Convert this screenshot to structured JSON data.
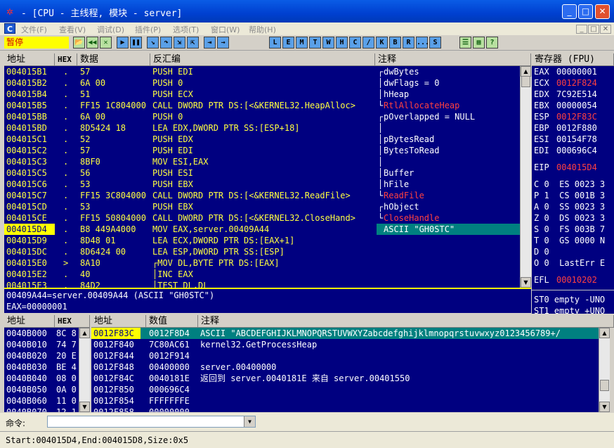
{
  "window": {
    "title": "- [CPU - 主线程, 模块 - server]",
    "minimize_glyph": "_",
    "maximize_glyph": "□",
    "close_glyph": "✕",
    "app_icon_glyph": "✲"
  },
  "menu": {
    "items": [
      "文件(F)",
      "查看(V)",
      "调试(D)",
      "插件(P)",
      "选项(T)",
      "窗口(W)",
      "帮助(H)"
    ]
  },
  "toolbar": {
    "status": "暂停",
    "buttons": [
      {
        "icon": "open-icon",
        "glyph": "📂"
      },
      {
        "icon": "rewind-icon",
        "glyph": "◀◀"
      },
      {
        "icon": "close-program-icon",
        "glyph": "✕"
      },
      {
        "icon": "run-icon",
        "glyph": "▶"
      },
      {
        "icon": "pause-icon",
        "glyph": "❚❚"
      },
      {
        "icon": "step-into-icon",
        "glyph": "↘"
      },
      {
        "icon": "step-over-icon",
        "glyph": "↷"
      },
      {
        "icon": "trace-into-icon",
        "glyph": "⇲"
      },
      {
        "icon": "trace-over-icon",
        "glyph": "⇱"
      },
      {
        "icon": "execute-till-return-icon",
        "glyph": "⇥"
      },
      {
        "icon": "goto-icon",
        "glyph": "→"
      }
    ],
    "letters": [
      "L",
      "E",
      "M",
      "T",
      "W",
      "H",
      "C",
      "/",
      "K",
      "B",
      "R",
      "...",
      "S"
    ],
    "extra": [
      {
        "icon": "list-icon",
        "glyph": "☰"
      },
      {
        "icon": "options-icon",
        "glyph": "▦"
      },
      {
        "icon": "help-icon",
        "glyph": "?"
      }
    ]
  },
  "disasm": {
    "headers": {
      "address": "地址",
      "hex": "HEX",
      "data": "数据",
      "disasm": "反汇编",
      "comment": "注释"
    },
    "rows": [
      {
        "addr": "004015B1",
        "mark": ".",
        "hex": "57",
        "asm": "PUSH EDI",
        "bracket": "┌",
        "comment": "dwBytes",
        "cc": "w"
      },
      {
        "addr": "004015B2",
        "mark": ".",
        "hex": "6A 00",
        "asm": "PUSH 0",
        "bracket": "│",
        "comment": "dwFlags = 0",
        "cc": "w"
      },
      {
        "addr": "004015B4",
        "mark": ".",
        "hex": "51",
        "asm": "PUSH ECX",
        "bracket": "│",
        "comment": "hHeap",
        "cc": "w"
      },
      {
        "addr": "004015B5",
        "mark": ".",
        "hex": "FF15 1C804000",
        "asm": "CALL DWORD PTR DS:[<&KERNEL32.HeapAlloc>",
        "bracket": "└",
        "comment": "RtlAllocateHeap",
        "cc": "r"
      },
      {
        "addr": "004015BB",
        "mark": ".",
        "hex": "6A 00",
        "asm": "PUSH 0",
        "bracket": "┌",
        "comment": "pOverlapped = NULL",
        "cc": "w"
      },
      {
        "addr": "004015BD",
        "mark": ".",
        "hex": "8D5424 18",
        "asm": "LEA EDX,DWORD PTR SS:[ESP+18]",
        "bracket": "│",
        "comment": "",
        "cc": "w"
      },
      {
        "addr": "004015C1",
        "mark": ".",
        "hex": "52",
        "asm": "PUSH EDX",
        "bracket": "│",
        "comment": "pBytesRead",
        "cc": "w"
      },
      {
        "addr": "004015C2",
        "mark": ".",
        "hex": "57",
        "asm": "PUSH EDI",
        "bracket": "│",
        "comment": "BytesToRead",
        "cc": "w"
      },
      {
        "addr": "004015C3",
        "mark": ".",
        "hex": "8BF0",
        "asm": "MOV ESI,EAX",
        "bracket": "│",
        "comment": "",
        "cc": "w"
      },
      {
        "addr": "004015C5",
        "mark": ".",
        "hex": "56",
        "asm": "PUSH ESI",
        "bracket": "│",
        "comment": "Buffer",
        "cc": "w"
      },
      {
        "addr": "004015C6",
        "mark": ".",
        "hex": "53",
        "asm": "PUSH EBX",
        "bracket": "│",
        "comment": "hFile",
        "cc": "w"
      },
      {
        "addr": "004015C7",
        "mark": ".",
        "hex": "FF15 3C804000",
        "asm": "CALL DWORD PTR DS:[<&KERNEL32.ReadFile>",
        "bracket": "└",
        "comment": "ReadFile",
        "cc": "r"
      },
      {
        "addr": "004015CD",
        "mark": ".",
        "hex": "53",
        "asm": "PUSH EBX",
        "bracket": "┌",
        "comment": "hObject",
        "cc": "w"
      },
      {
        "addr": "004015CE",
        "mark": ".",
        "hex": "FF15 50804000",
        "asm": "CALL DWORD PTR DS:[<&KERNEL32.CloseHand>",
        "bracket": "└",
        "comment": "CloseHandle",
        "cc": "r"
      },
      {
        "addr": "004015D4",
        "mark": ".",
        "hex": "B8 449A4000",
        "asm": "MOV EAX,server.00409A44",
        "bracket": "",
        "comment": "ASCII \"GH0STC\"",
        "cc": "w",
        "selected": true
      },
      {
        "addr": "004015D9",
        "mark": ".",
        "hex": "8D48 01",
        "asm": "LEA ECX,DWORD PTR DS:[EAX+1]",
        "bracket": "",
        "comment": "",
        "cc": "w"
      },
      {
        "addr": "004015DC",
        "mark": ".",
        "hex": "8D6424 00",
        "asm": "LEA ESP,DWORD PTR SS:[ESP]",
        "bracket": "",
        "comment": "",
        "cc": "w"
      },
      {
        "addr": "004015E0",
        "mark": ">",
        "hex": "8A10",
        "asm": "┌MOV DL,BYTE PTR DS:[EAX]",
        "bracket": "",
        "comment": "",
        "cc": "w"
      },
      {
        "addr": "004015E2",
        "mark": ".",
        "hex": "40",
        "asm": "│INC EAX",
        "bracket": "",
        "comment": "",
        "cc": "w"
      },
      {
        "addr": "004015E3",
        "mark": ".",
        "hex": "84D2",
        "asm": "│TEST DL,DL",
        "bracket": "",
        "comment": "",
        "cc": "w"
      }
    ]
  },
  "info": {
    "line1": "00409A44=server.00409A44 (ASCII \"GH0STC\")",
    "line2": "EAX=00000001"
  },
  "registers": {
    "header": "寄存器 (FPU)",
    "gp": [
      {
        "n": "EAX",
        "v": "00000001",
        "hl": false
      },
      {
        "n": "ECX",
        "v": "0012F824",
        "hl": true
      },
      {
        "n": "EDX",
        "v": "7C92E514",
        "x": "n"
      },
      {
        "n": "EBX",
        "v": "00000054",
        "hl": false
      },
      {
        "n": "ESP",
        "v": "0012F83C",
        "hl": true
      },
      {
        "n": "EBP",
        "v": "0012F880",
        "hl": false
      },
      {
        "n": "ESI",
        "v": "00154F78",
        "hl": false
      },
      {
        "n": "EDI",
        "v": "000696C4",
        "hl": false
      }
    ],
    "eip": {
      "n": "EIP",
      "v": "004015D4"
    },
    "flags": [
      "C 0  ES 0023 3",
      "P 1  CS 001B 3",
      "A 0  SS 0023 3",
      "Z 0  DS 0023 3",
      "S 0  FS 003B 7",
      "T 0  GS 0000 N",
      "D 0",
      "O 0  LastErr E"
    ],
    "efl": {
      "n": "EFL",
      "v": "00010202"
    },
    "fpu": [
      "ST0 empty -UNO",
      "ST1 empty +UNO"
    ]
  },
  "dump": {
    "headers": {
      "address": "地址",
      "hex": "HEX"
    },
    "rows": [
      [
        "0040B000",
        "8C 8"
      ],
      [
        "0040B010",
        "74 7"
      ],
      [
        "0040B020",
        "20 E"
      ],
      [
        "0040B030",
        "BE 4"
      ],
      [
        "0040B040",
        "08 0"
      ],
      [
        "0040B050",
        "0A 0"
      ],
      [
        "0040B060",
        "11 0"
      ],
      [
        "0040B070",
        "12 1"
      ]
    ]
  },
  "stack": {
    "headers": {
      "address": "地址",
      "value": "数值",
      "comment": "注释"
    },
    "rows": [
      {
        "addr": "0012F83C",
        "val": "0012F8D4",
        "comment": "ASCII \"ABCDEFGHIJKLMNOPQRSTUVWXYZabcdefghijklmnopqrstuvwxyz0123456789+/",
        "selected": true
      },
      {
        "addr": "0012F840",
        "val": "7C80AC61",
        "comment": "kernel32.GetProcessHeap"
      },
      {
        "addr": "0012F844",
        "val": "0012F914",
        "comment": ""
      },
      {
        "addr": "0012F848",
        "val": "00400000",
        "comment": "server.00400000"
      },
      {
        "addr": "0012F84C",
        "val": "0040181E",
        "comment": "返回到 server.0040181E 来自 server.00401550"
      },
      {
        "addr": "0012F850",
        "val": "000696C4",
        "comment": ""
      },
      {
        "addr": "0012F854",
        "val": "FFFFFFFE",
        "comment": ""
      },
      {
        "addr": "0012F858",
        "val": "00000000",
        "comment": ""
      }
    ]
  },
  "command": {
    "label": "命令:",
    "value": ""
  },
  "status": {
    "text": "Start:004015D4,End:004015D8,Size:0x5"
  }
}
